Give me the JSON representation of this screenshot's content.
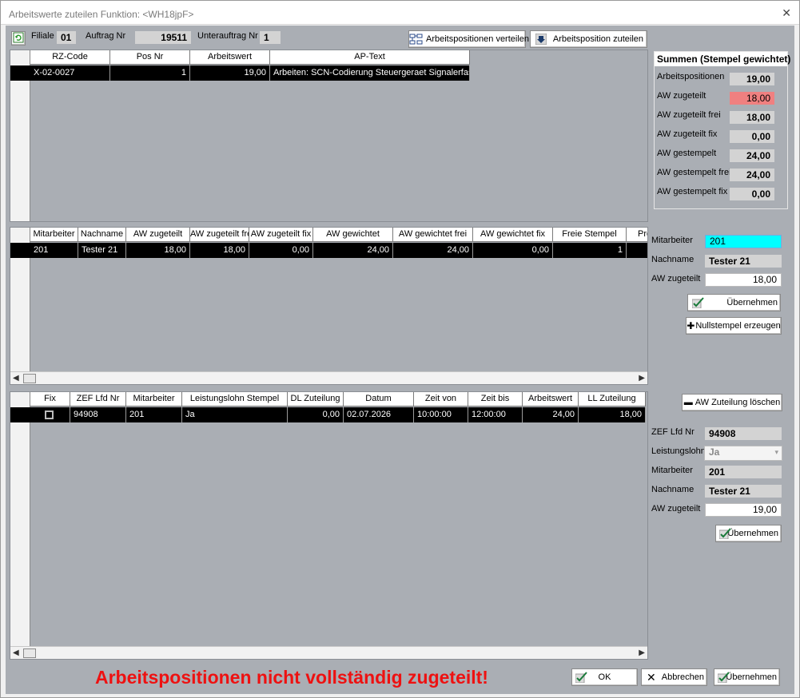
{
  "window": {
    "title": "Arbeitswerte zuteilen Funktion: <WH18jpF>",
    "close_glyph": "✕"
  },
  "toolbar": {
    "filiale_label": "Filiale",
    "filiale_value": "01",
    "auftrag_label": "Auftrag Nr",
    "auftrag_value": "19511",
    "unterauftrag_label": "Unterauftrag Nr",
    "unterauftrag_value": "1",
    "verteilen_label": "Arbeitspositionen verteilen",
    "zuteilen_label": "Arbeitsposition zuteilen"
  },
  "grid1": {
    "headers": [
      "RZ-Code",
      "Pos Nr",
      "Arbeitswert",
      "AP-Text"
    ],
    "row": [
      "X-02-0027",
      "1",
      "19,00",
      "Arbeiten: SCN-Codierung Steuergeraet Signalerfas"
    ]
  },
  "summen": {
    "title": "Summen (Stempel gewichtet)",
    "rows": [
      {
        "label": "Arbeitspositionen",
        "value": "19,00"
      },
      {
        "label": "AW zugeteilt",
        "value": "18,00"
      },
      {
        "label": "AW zugeteilt frei",
        "value": "18,00"
      },
      {
        "label": "AW zugeteilt fix",
        "value": "0,00"
      },
      {
        "label": "AW gestempelt",
        "value": "24,00"
      },
      {
        "label": "AW gestempelt frei",
        "value": "24,00"
      },
      {
        "label": "AW gestempelt fix",
        "value": "0,00"
      }
    ],
    "highlight_color": "#f08080"
  },
  "grid2": {
    "headers": [
      "Mitarbeiter",
      "Nachname",
      "AW zugeteilt",
      "AW zugeteilt frei",
      "AW zugeteilt fix",
      "AW gewichtet",
      "AW gewichtet frei",
      "AW gewichtet fix",
      "Freie Stempel",
      "Pro"
    ],
    "row": [
      "201",
      "Tester 21",
      "18,00",
      "18,00",
      "0,00",
      "24,00",
      "24,00",
      "0,00",
      "1",
      ""
    ]
  },
  "edit2": {
    "mitarbeiter_label": "Mitarbeiter",
    "mitarbeiter_value": "201",
    "nachname_label": "Nachname",
    "nachname_value": "Tester 21",
    "aw_label": "AW zugeteilt",
    "aw_value": "18,00",
    "uebernehmen_label": "Übernehmen",
    "nullstempel_label": "Nullstempel erzeugen",
    "highlight_color": "#00ffff"
  },
  "grid3": {
    "headers": [
      "Fix",
      "ZEF Lfd Nr",
      "Mitarbeiter",
      "Leistungslohn Stempel",
      "DL Zuteilung",
      "Datum",
      "Zeit von",
      "Zeit bis",
      "Arbeitswert",
      "LL Zuteilung"
    ],
    "row": [
      "",
      "94908",
      "201",
      "Ja",
      "0,00",
      "02.07.2026",
      "10:00:00",
      "12:00:00",
      "24,00",
      "18,00"
    ]
  },
  "edit3": {
    "loeschen_label": "AW Zuteilung löschen",
    "zef_label": "ZEF Lfd Nr",
    "zef_value": "94908",
    "leistungslohn_label": "Leistungslohn",
    "leistungslohn_value": "Ja",
    "mitarbeiter_label": "Mitarbeiter",
    "mitarbeiter_value": "201",
    "nachname_label": "Nachname",
    "nachname_value": "Tester 21",
    "aw_label": "AW zugeteilt",
    "aw_value": "19,00",
    "uebernehmen_label": "Übernehmen"
  },
  "footer": {
    "warning": "Arbeitspositionen nicht vollständig zugeteilt!",
    "ok_label": "OK",
    "abbrechen_label": "Abbrechen",
    "uebernehmen_label": "Übernehmen"
  }
}
